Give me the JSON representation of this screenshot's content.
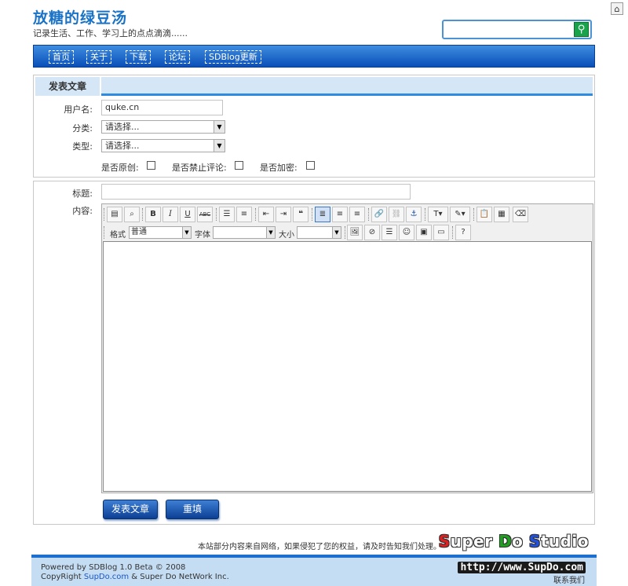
{
  "header": {
    "title": "放糖的绿豆汤",
    "subtitle": "记录生活、工作、学习上的点点滴滴......",
    "search_placeholder": "",
    "search_icon": "search-icon",
    "home_icon": "home-icon"
  },
  "nav": {
    "items": [
      {
        "label": "首页"
      },
      {
        "label": "关于"
      },
      {
        "label": "下载"
      },
      {
        "label": "论坛"
      },
      {
        "label": "SDBlog更新"
      }
    ]
  },
  "form": {
    "tab_label": "发表文章",
    "username_label": "用户名:",
    "username_value": "quke.cn",
    "category_label": "分类:",
    "category_value": "请选择...",
    "type_label": "类型:",
    "type_value": "请选择...",
    "original_label": "是否原创:",
    "no_comment_label": "是否禁止评论:",
    "encrypt_label": "是否加密:",
    "title_label": "标题:",
    "title_value": "",
    "content_label": "内容:"
  },
  "editor": {
    "format_label": "格式",
    "format_value": "普通",
    "font_label": "字体",
    "font_value": "",
    "size_label": "大小",
    "size_value": "",
    "bold": "B",
    "italic": "I",
    "underline": "U",
    "strike": "ABC"
  },
  "buttons": {
    "submit_label": "发表文章",
    "reset_label": "重填"
  },
  "footer": {
    "note": "本站部分内容来自网络，如果侵犯了您的权益，请及时告知我们处理。",
    "powered": "Powered by SDBlog 1.0 Beta © 2008",
    "copyright_prefix": "CopyRight ",
    "copyright_link": "SupDo.com",
    "copyright_suffix": " & Super Do NetWork Inc.",
    "brand_s1": "S",
    "brand_t1": "uper ",
    "brand_s2": "D",
    "brand_t2": "o ",
    "brand_s3": "S",
    "brand_t3": "tudio",
    "brand_url": "http://www.SupDo.com",
    "contact": "联系我们",
    "brand_colors": {
      "s": "#e02020",
      "d": "#20a020",
      "s2": "#2050e0"
    }
  }
}
